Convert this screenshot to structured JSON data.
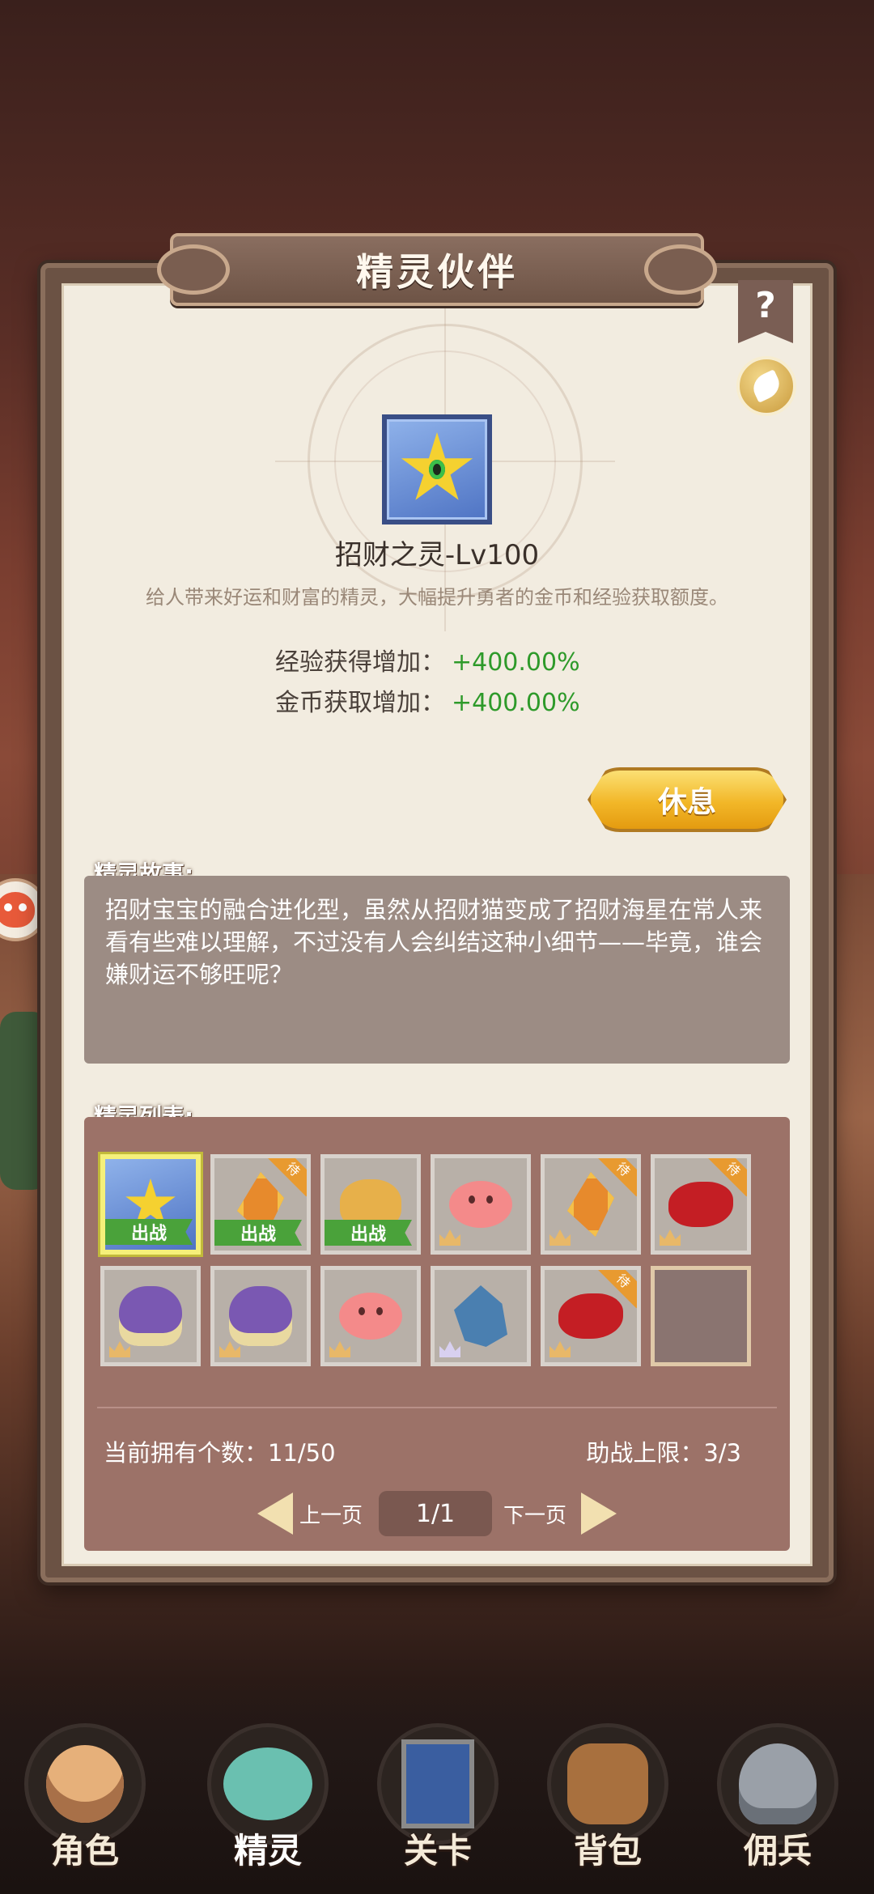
{
  "header": {
    "title": "精灵伙伴",
    "help_icon": "?"
  },
  "featured": {
    "name": "招财之灵-Lv100",
    "description": "给人带来好运和财富的精灵，大幅提升勇者的金币和经验获取额度。",
    "stats": [
      {
        "label": "经验获得增加：",
        "value": "+400.00%"
      },
      {
        "label": "金币获取增加：",
        "value": "+400.00%"
      }
    ],
    "value_color": "#2e9a2a"
  },
  "actions": {
    "rest_label": "休息"
  },
  "story": {
    "label": "精灵故事:",
    "text": "招财宝宝的融合进化型，虽然从招财猫变成了招财海星在常人来看有些难以理解，不过没有人会纠结这种小细节——毕竟，谁会嫌财运不够旺呢？"
  },
  "list": {
    "label": "精灵列表:",
    "battle_tag": "出战",
    "wait_tag": "待",
    "slots": [
      {
        "icon": "star-spirit-icon",
        "battle": true,
        "selected": true
      },
      {
        "icon": "crystal-spirit-icon",
        "battle": true,
        "wait": true
      },
      {
        "icon": "cat-spirit-icon",
        "battle": true
      },
      {
        "icon": "pink-blob-icon",
        "crown": "gold"
      },
      {
        "icon": "crystal-spirit-icon",
        "crown": "gold",
        "wait": true
      },
      {
        "icon": "red-spirit-icon",
        "crown": "gold",
        "wait": true
      },
      {
        "icon": "purple-helmet-icon",
        "crown": "gold"
      },
      {
        "icon": "purple-helmet-icon",
        "crown": "gold"
      },
      {
        "icon": "pink-blob-icon",
        "crown": "gold"
      },
      {
        "icon": "blue-dragon-icon",
        "crown": "silver"
      },
      {
        "icon": "red-spirit-icon",
        "crown": "gold",
        "wait": true
      },
      {
        "icon": "empty-slot",
        "empty": true
      }
    ],
    "owned_count": "当前拥有个数：11/50",
    "assist_limit": "助战上限：3/3",
    "pager": {
      "prev": "上一页",
      "page": "1/1",
      "next": "下一页"
    }
  },
  "bottom_nav": [
    {
      "label": "角色",
      "icon": "hero-icon"
    },
    {
      "label": "精灵",
      "icon": "spirit-icon",
      "active": true
    },
    {
      "label": "关卡",
      "icon": "stage-icon"
    },
    {
      "label": "背包",
      "icon": "backpack-icon"
    },
    {
      "label": "佣兵",
      "icon": "mercenary-icon"
    }
  ]
}
